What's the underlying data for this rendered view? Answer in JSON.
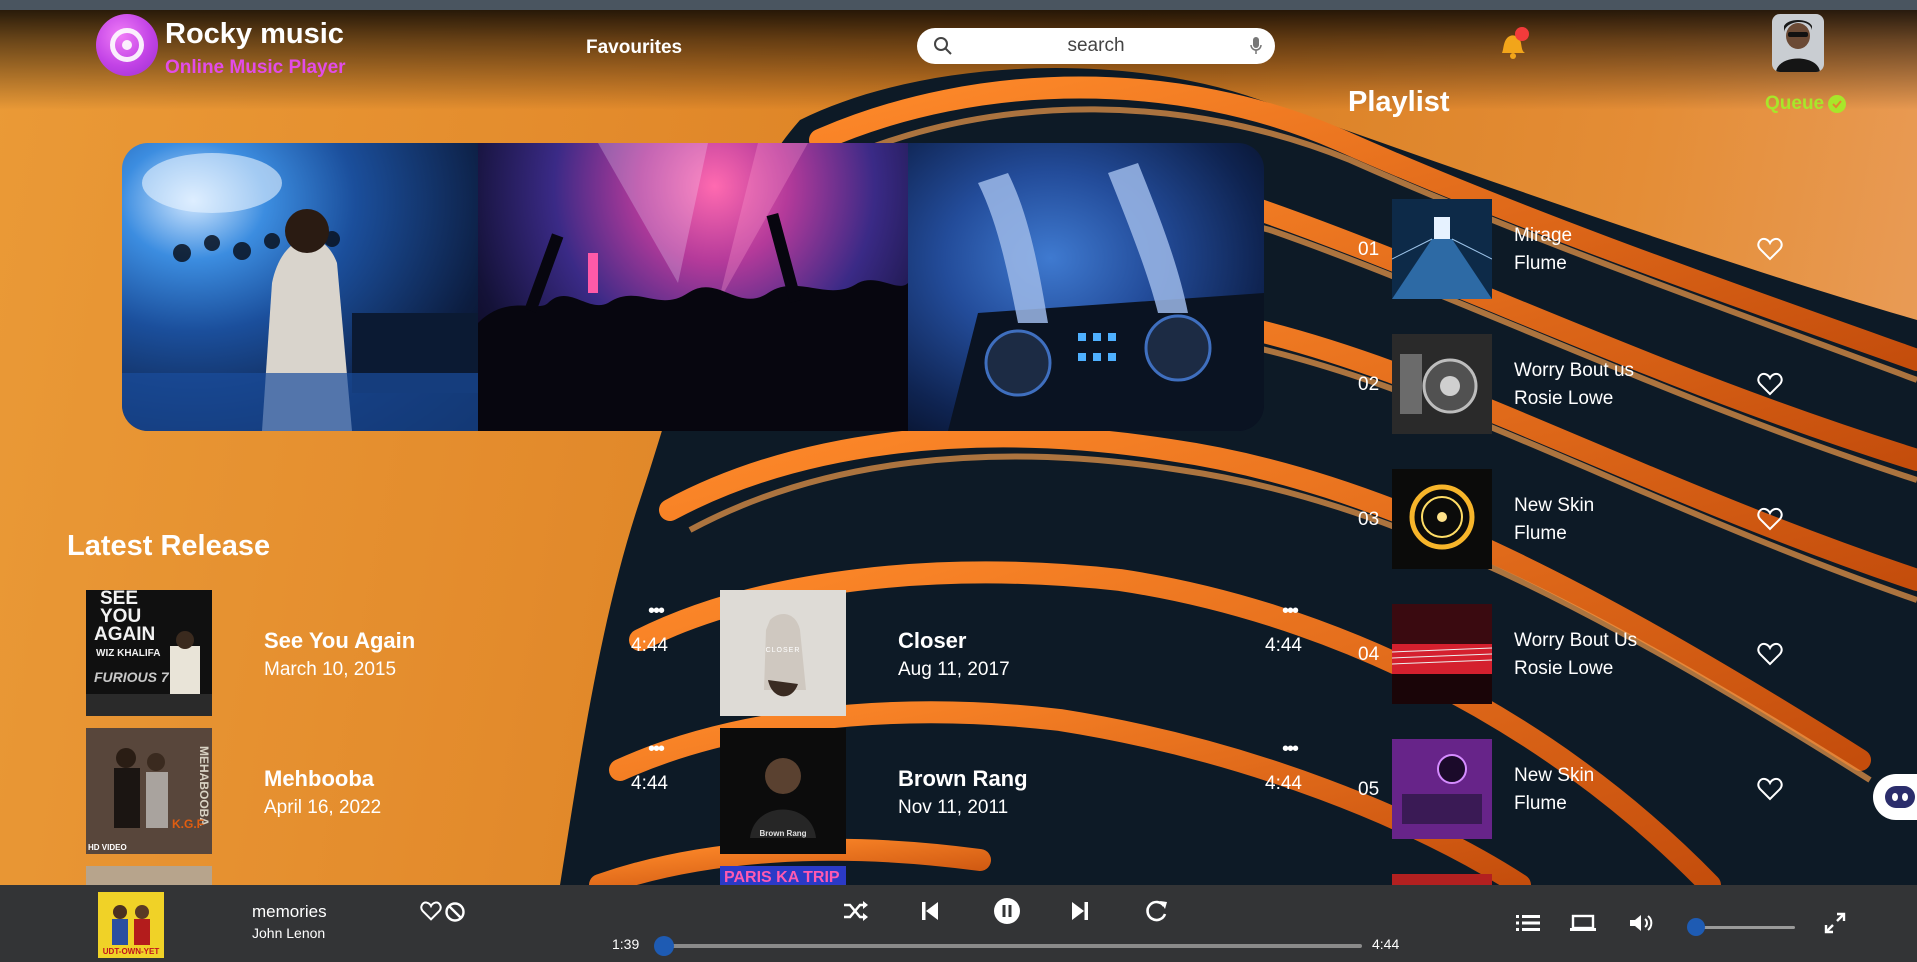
{
  "header": {
    "app_title": "Rocky music",
    "app_subtitle": "Online Music Player",
    "nav_favourites": "Favourites",
    "search_placeholder": "search"
  },
  "latest": {
    "title": "Latest Release",
    "items": [
      {
        "title": "See You Again",
        "date": "March 10, 2015",
        "more": "•••",
        "duration": "4:44"
      },
      {
        "title": "Closer",
        "date": "Aug 11, 2017",
        "more": "•••",
        "duration": "4:44"
      },
      {
        "title": "Mehbooba",
        "date": "April 16, 2022",
        "more": "•••",
        "duration": "4:44"
      },
      {
        "title": "Brown Rang",
        "date": "Nov 11, 2011",
        "more": "•••",
        "duration": "4:44"
      }
    ],
    "cover_texts": {
      "see_you_again": [
        "SEE",
        "YOU",
        "AGAIN",
        "WIZ KHALIFA",
        "FURIOUS 7"
      ],
      "closer": "CLOSER",
      "mehbooba": [
        "MEHABOOBA",
        "K.G.F",
        "HD VIDEO"
      ],
      "brown_rang": [
        "Brown Rang"
      ],
      "paris": "PARIS KA TRIP"
    }
  },
  "playlist": {
    "title": "Playlist",
    "queue_label": "Queue",
    "items": [
      {
        "num": "01",
        "title": "Mirage",
        "artist": "Flume"
      },
      {
        "num": "02",
        "title": "Worry Bout us",
        "artist": "Rosie Lowe"
      },
      {
        "num": "03",
        "title": "New Skin",
        "artist": "Flume"
      },
      {
        "num": "04",
        "title": "Worry Bout Us",
        "artist": "Rosie Lowe"
      },
      {
        "num": "05",
        "title": "New Skin",
        "artist": "Flume"
      }
    ]
  },
  "player": {
    "now_playing_title": "memories",
    "now_playing_artist": "John Lenon",
    "cover_text": "UDT-OWN-YET",
    "elapsed": "1:39",
    "duration": "4:44",
    "progress": 0.0,
    "volume": 0.0
  },
  "colors": {
    "accent_purple": "#c243e6",
    "subtitle_pink": "#e24ce8",
    "queue_green": "#a8e62a",
    "knob_blue": "#1e5bb3",
    "player_bg": "#333436",
    "bell_yellow": "#f2a51a",
    "notification_red": "#f23b3b"
  },
  "icons": [
    "logo-disc-icon",
    "search-icon",
    "mic-icon",
    "bell-icon",
    "heart-icon",
    "block-icon",
    "shuffle-icon",
    "previous-icon",
    "pause-icon",
    "next-icon",
    "repeat-icon",
    "queue-list-icon",
    "screen-icon",
    "volume-icon",
    "fullscreen-icon",
    "check-icon",
    "bot-icon"
  ]
}
